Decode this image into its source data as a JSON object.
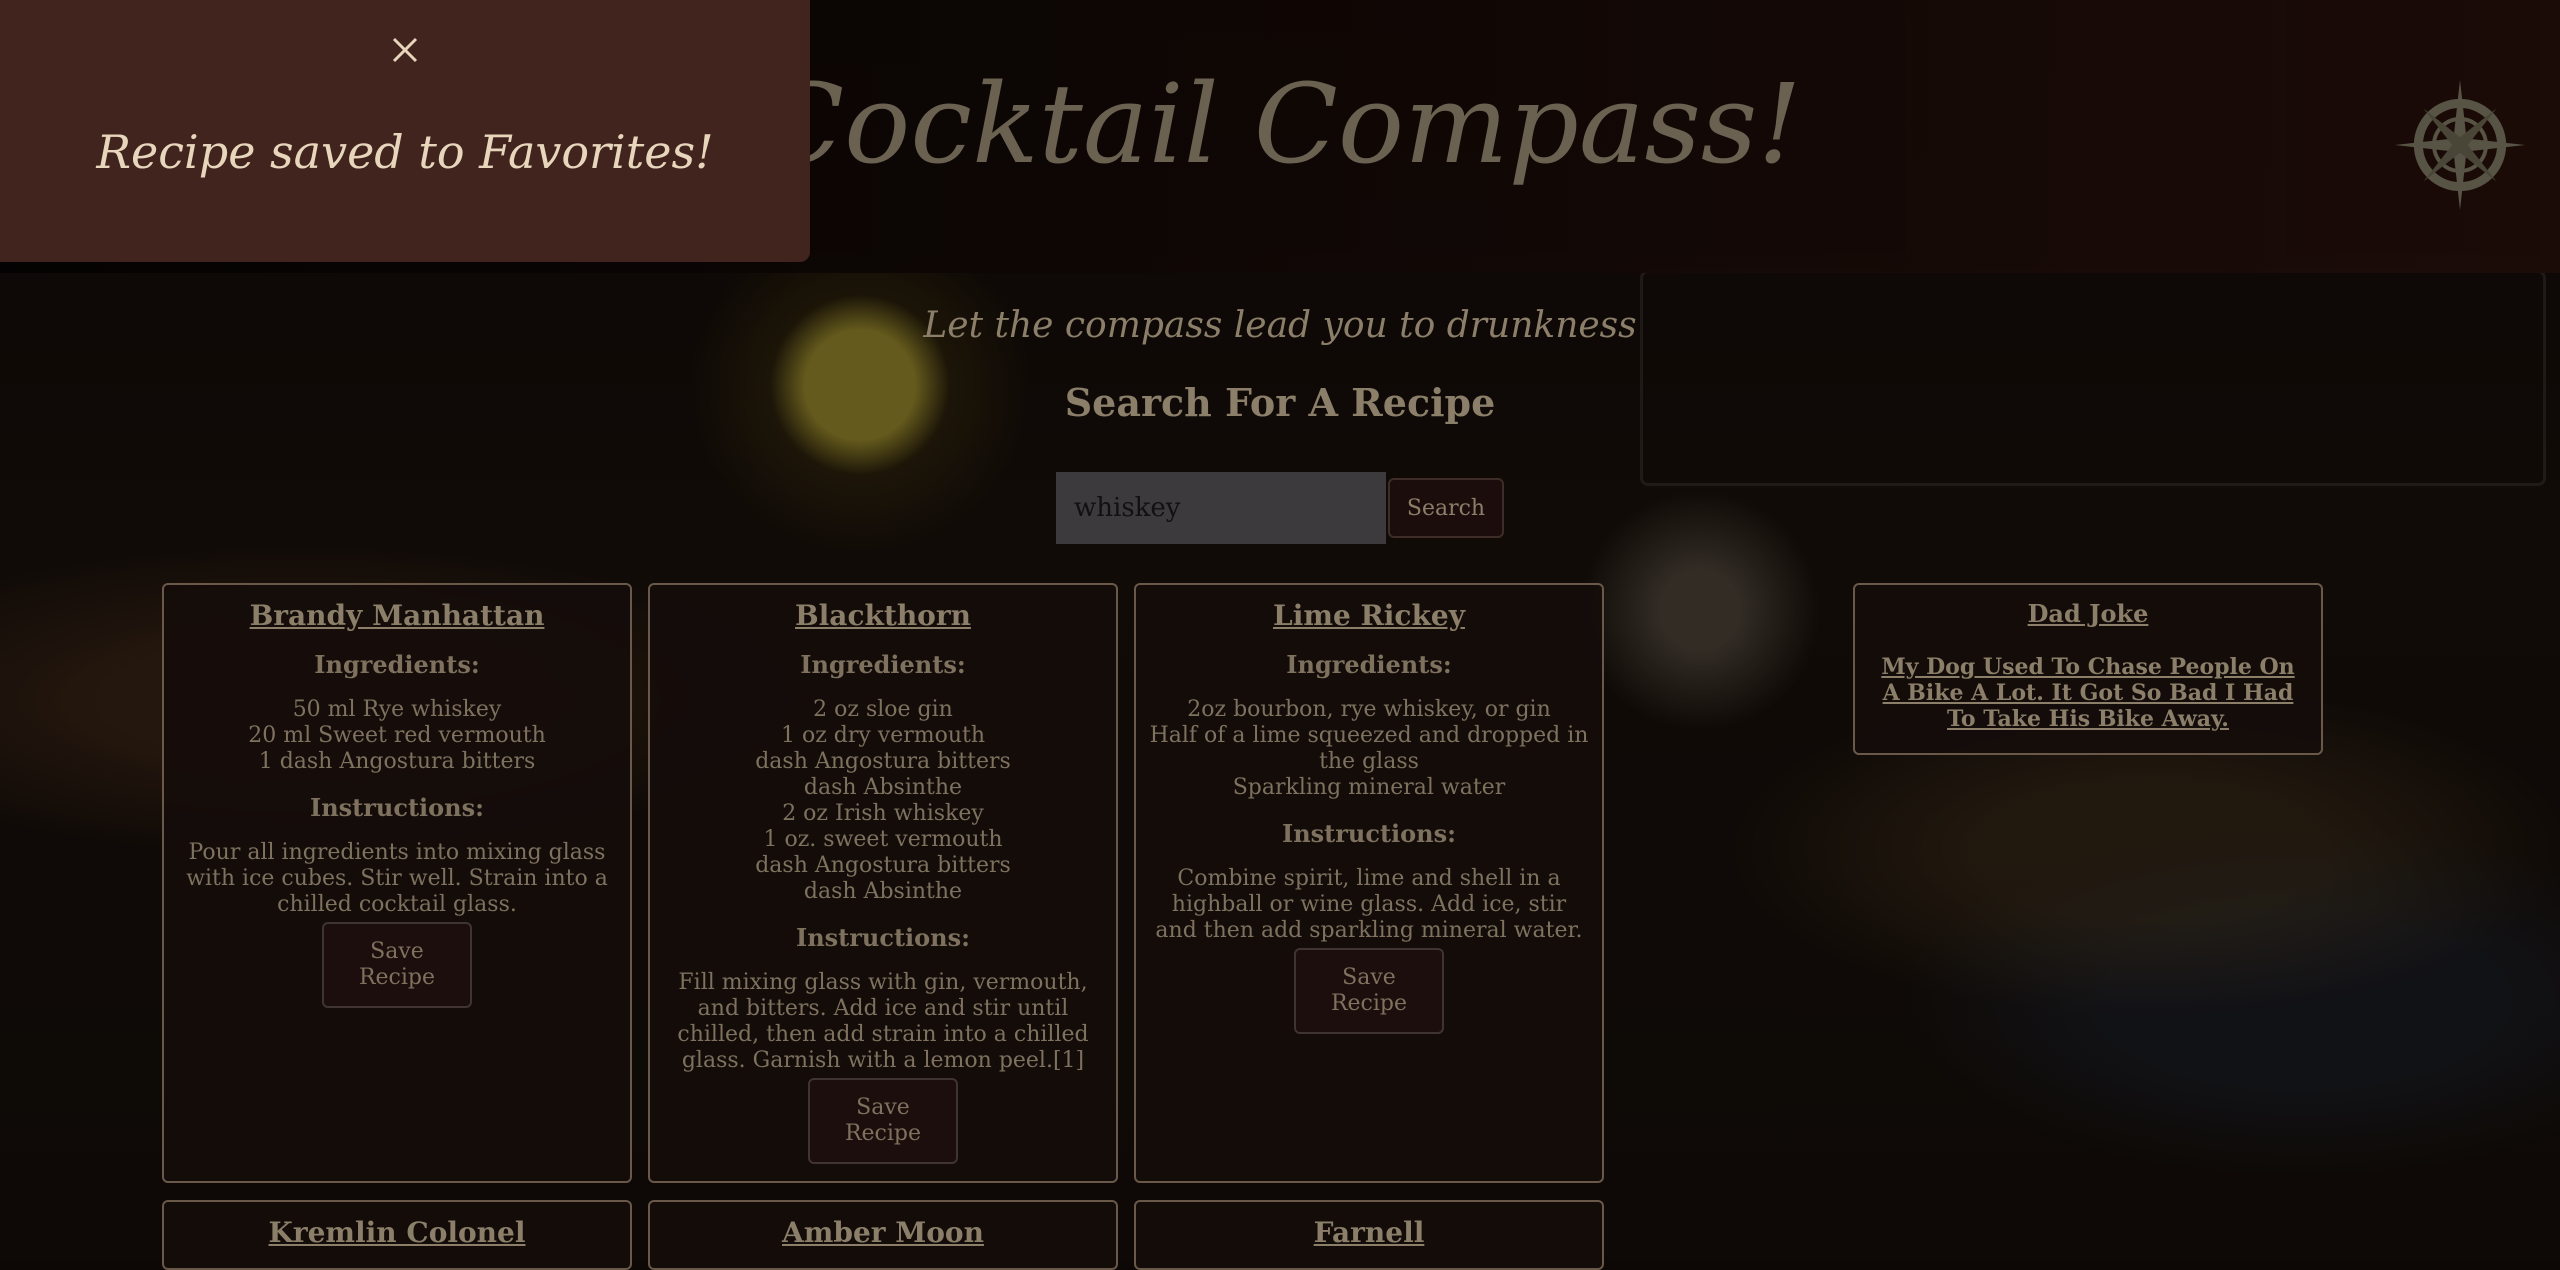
{
  "header": {
    "title": "Cocktail Compass!"
  },
  "hero": {
    "tagline": "Let the compass lead you to drunkness",
    "search_heading": "Search For A Recipe"
  },
  "search": {
    "value": "whiskey",
    "button_label": "Search"
  },
  "labels": {
    "ingredients": "Ingredients:",
    "instructions": "Instructions:",
    "save": "Save Recipe"
  },
  "recipes": [
    {
      "name": "Brandy Manhattan",
      "ingredients": [
        "50 ml Rye whiskey",
        "20 ml Sweet red vermouth",
        "1 dash Angostura bitters"
      ],
      "instructions": "Pour all ingredients into mixing glass with ice cubes. Stir well. Strain into a chilled cocktail glass."
    },
    {
      "name": "Blackthorn",
      "ingredients": [
        "2 oz sloe gin",
        "1 oz dry vermouth",
        "dash Angostura bitters",
        "dash Absinthe",
        "2 oz Irish whiskey",
        "1 oz. sweet vermouth",
        "dash Angostura bitters",
        "dash Absinthe"
      ],
      "instructions": "Fill mixing glass with gin, vermouth, and bitters. Add ice and stir until chilled, then add strain into a chilled glass. Garnish with a lemon peel.[1]"
    },
    {
      "name": "Lime Rickey",
      "ingredients": [
        "2oz bourbon, rye whiskey, or gin",
        "Half of a lime squeezed and dropped in the glass",
        "Sparkling mineral water"
      ],
      "instructions": "Combine spirit, lime and shell in a highball or wine glass. Add ice, stir and then add sparkling mineral water."
    },
    {
      "name": "Kremlin Colonel"
    },
    {
      "name": "Amber Moon"
    },
    {
      "name": "Farnell"
    }
  ],
  "joke": {
    "title": "Dad Joke",
    "text": "My Dog Used To Chase People On A Bike A Lot. It Got So Bad I Had To Take His Bike Away."
  },
  "toast": {
    "message": "Recipe saved to Favorites!"
  },
  "icons": {
    "close": "close-icon",
    "logo": "compass-icon"
  },
  "colors": {
    "toast_bg": "#42241f",
    "card_border": "#6a5848",
    "text": "#8c7f6a"
  }
}
